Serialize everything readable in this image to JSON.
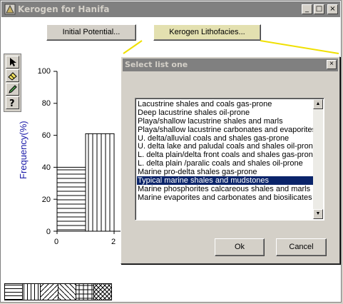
{
  "window": {
    "title": "Kerogen for Hanifa",
    "minimize": "_",
    "maximize": "□",
    "close": "×"
  },
  "toolbar": {
    "initial_potential_label": "Initial Potential...",
    "kerogen_lithofacies_label": "Kerogen Lithofacies..."
  },
  "chart_data": {
    "type": "bar",
    "ylabel": "Frequency(%)",
    "ylim": [
      0,
      100
    ],
    "yticks": [
      "0",
      "20",
      "40",
      "60",
      "80",
      "100"
    ],
    "xticks": [
      "0",
      "2"
    ],
    "bars": [
      {
        "x_start": 0,
        "x_end": 1,
        "value": 40,
        "pattern": "horizontal-lines"
      },
      {
        "x_start": 1,
        "x_end": 2,
        "value": 61,
        "pattern": "vertical-lines"
      }
    ]
  },
  "dialog": {
    "title": "Select list one",
    "close": "×",
    "ok_label": "Ok",
    "cancel_label": "Cancel",
    "selected_index": 10,
    "items": [
      "Lacustrine shales and coals gas-prone",
      "Deep lacustrine shales oil-prone",
      "Playa/shallow lacustrine shales and marls",
      "Playa/shallow lacustrine carbonates and evaporites",
      "U. delta/alluvial coals and shales gas-prone",
      "U. delta lake and paludal coals and shales oil-prone",
      "L. delta plain/delta front coals and shales gas-prone",
      "L. delta plain /paralic coals and shales oil-prone",
      "Marine pro-delta  shales gas-prone",
      "Typical marine shales and mudstones",
      "Marine phosphorites calcareous shales and marls",
      "Marine evaporites and carbonates and biosilicates"
    ]
  },
  "legend_patterns": [
    "horizontal-lines",
    "vertical-lines",
    "diagonal-lines",
    "anti-diagonal-lines",
    "grid",
    "crosshatch"
  ],
  "colors": {
    "title_bar": "#808080",
    "selection": "#0a246a",
    "axis_label": "#1a1aa8",
    "highlight_line": "#f0e000"
  }
}
